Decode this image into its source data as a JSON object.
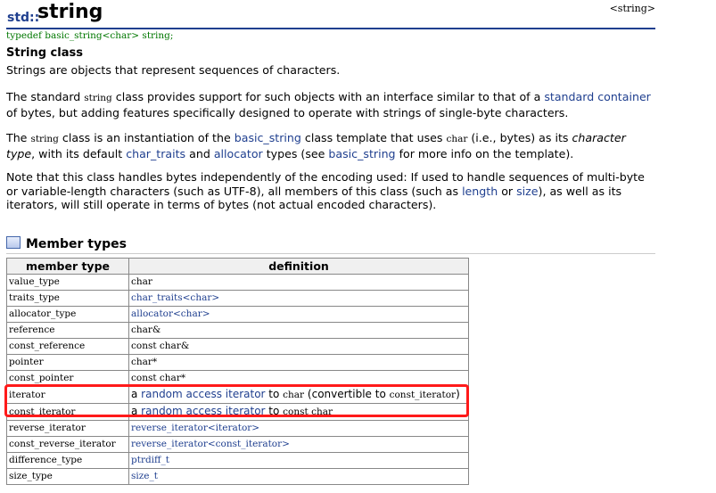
{
  "header": {
    "namespace": "std::",
    "title": "string",
    "header_file": "<string>",
    "typedef": "typedef basic_string<char> string;"
  },
  "class_heading": "String class",
  "p1": "Strings are objects that represent sequences of characters.",
  "p2": {
    "t1": "The standard ",
    "c1": "string",
    "t2": " class provides support for such objects with an interface similar to that of a ",
    "l1": "standard container",
    "t3": " of bytes, but adding features specifically designed to operate with strings of single-byte characters."
  },
  "p3": {
    "t1": "The ",
    "c1": "string",
    "t2": " class is an instantiation of the ",
    "l1": "basic_string",
    "t3": " class template that uses ",
    "c2": "char",
    "t4": " (i.e., bytes) as its ",
    "i1": "character type",
    "t5": ", with its default ",
    "l2": "char_traits",
    "t6": " and ",
    "l3": "allocator",
    "t7": " types (see ",
    "l4": "basic_string",
    "t8": " for more info on the template)."
  },
  "p4": {
    "t1": "Note that this class handles bytes independently of the encoding used: If used to handle sequences of multi-byte or variable-length characters (such as UTF-8), all members of this class (such as ",
    "l1": "length",
    "t2": " or ",
    "l2": "size",
    "t3": "), as well as its iterators, will still operate in terms of bytes (not actual encoded characters)."
  },
  "member_types": {
    "heading": "Member types",
    "headers": [
      "member type",
      "definition"
    ],
    "rows": {
      "r0": {
        "name": "value_type",
        "def": "char"
      },
      "r1": {
        "name": "traits_type",
        "def": "char_traits<char>"
      },
      "r2": {
        "name": "allocator_type",
        "def": "allocator<char>"
      },
      "r3": {
        "name": "reference",
        "def": "char&"
      },
      "r4": {
        "name": "const_reference",
        "def": "const char&"
      },
      "r5": {
        "name": "pointer",
        "def": "char*"
      },
      "r6": {
        "name": "const_pointer",
        "def": "const char*"
      },
      "r7": {
        "name": "iterator",
        "pre": "a ",
        "link": "random access iterator",
        "mid": " to ",
        "code": "char",
        "post1": " (convertible to ",
        "code2": "const_iterator",
        "post2": ")"
      },
      "r8": {
        "name": "const_iterator",
        "pre": "a ",
        "link": "random access iterator",
        "mid": " to ",
        "code": "const char"
      },
      "r9": {
        "name": "reverse_iterator",
        "def": "reverse_iterator<iterator>"
      },
      "r10": {
        "name": "const_reverse_iterator",
        "def": "reverse_iterator<const_iterator>"
      },
      "r11": {
        "name": "difference_type",
        "def": "ptrdiff_t"
      },
      "r12": {
        "name": "size_type",
        "def": "size_t"
      }
    }
  },
  "highlight_color": "#ff1a1a",
  "link_color": "#1f3f8f"
}
